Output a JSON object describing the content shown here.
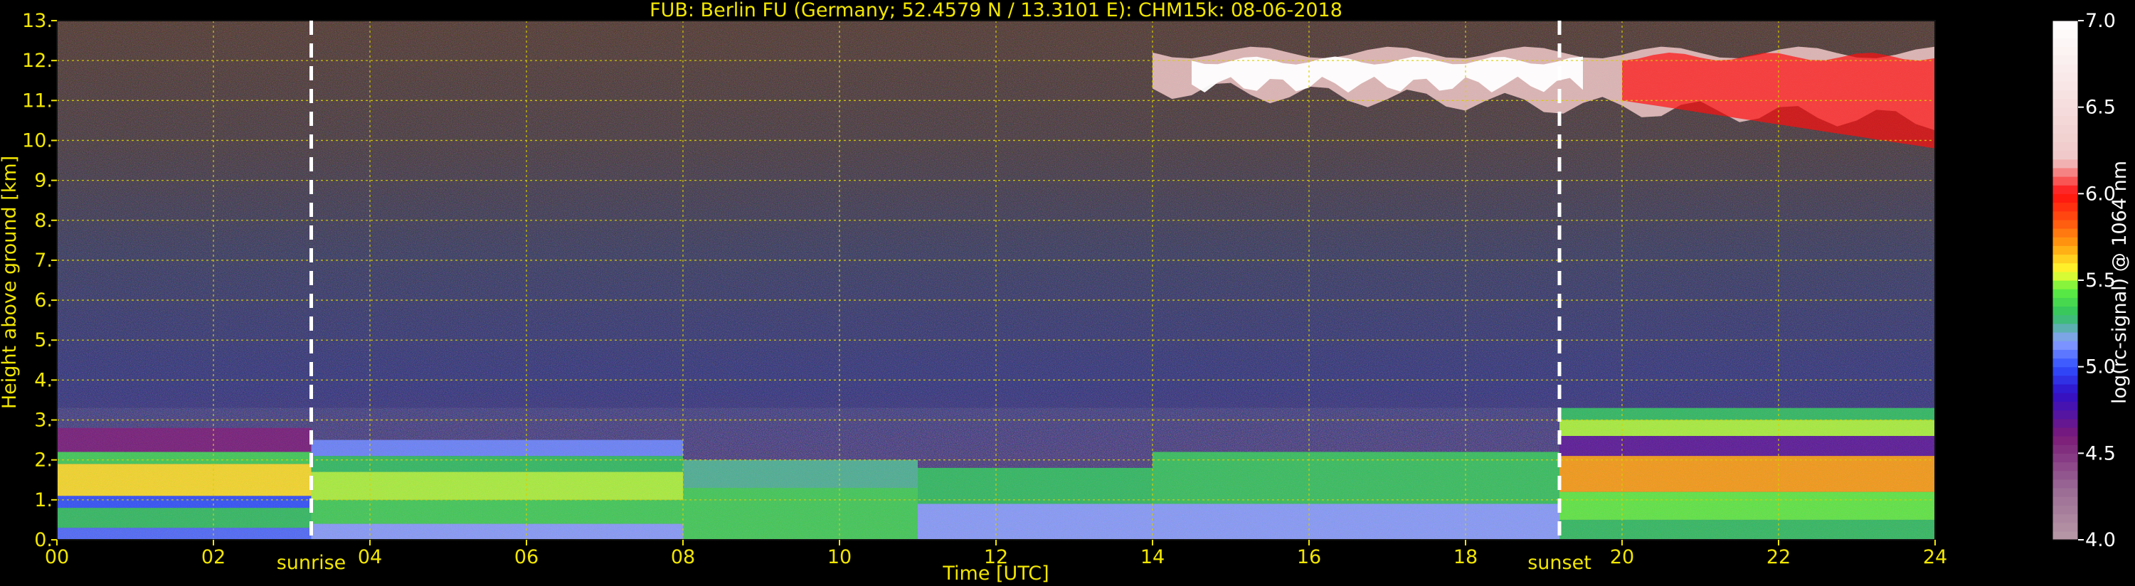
{
  "chart_data": {
    "type": "heatmap",
    "title": "FUB: Berlin FU (Germany; 52.4579 N / 13.3101 E):    CHM15k: 08-06-2018",
    "xlabel": "Time [UTC]",
    "ylabel": "Height above ground [km]",
    "xlim": [
      0,
      24
    ],
    "ylim": [
      0,
      13
    ],
    "x_ticks": [
      0,
      2,
      4,
      6,
      8,
      10,
      12,
      14,
      16,
      18,
      20,
      22,
      24
    ],
    "x_tick_labels": [
      "00",
      "02",
      "04",
      "06",
      "08",
      "10",
      "12",
      "14",
      "16",
      "18",
      "20",
      "22",
      "24"
    ],
    "y_ticks": [
      0,
      1,
      2,
      3,
      4,
      5,
      6,
      7,
      8,
      9,
      10,
      11,
      12,
      13
    ],
    "y_tick_labels": [
      "0.",
      "1.",
      "2.",
      "3.",
      "4.",
      "5.",
      "6.",
      "7.",
      "8.",
      "9.",
      "10.",
      "11.",
      "12.",
      "13."
    ],
    "grid": true,
    "markers": [
      {
        "label": "sunrise",
        "x": 3.25
      },
      {
        "label": "sunset",
        "x": 19.2
      }
    ],
    "colorbar": {
      "label": "log(rc-signal) @ 1064 nm",
      "min": 4.0,
      "max": 7.0,
      "ticks": [
        4.0,
        4.5,
        5.0,
        5.5,
        6.0,
        6.5,
        7.0
      ],
      "tick_labels": [
        "4.0",
        "4.5",
        "5.0",
        "5.5",
        "6.0",
        "6.5",
        "7.0"
      ]
    },
    "features": [
      {
        "kind": "boundary-layer",
        "x": [
          0,
          3.25
        ],
        "ymin": 0,
        "ymax": 2.2,
        "value": 5.6
      },
      {
        "kind": "boundary-layer",
        "x": [
          3.25,
          8
        ],
        "ymin": 0,
        "ymax": 2.0,
        "value": 5.4
      },
      {
        "kind": "convective-layer",
        "x": [
          8,
          19.2
        ],
        "ymin": 0,
        "ymax": 2.2,
        "value": 5.3
      },
      {
        "kind": "residual-layer",
        "x": [
          19.2,
          24
        ],
        "ymin": 0,
        "ymax": 3.3,
        "value": 5.7
      },
      {
        "kind": "cirrus-cloud",
        "x": [
          14,
          24
        ],
        "ymin": 9.6,
        "ymax": 12.3,
        "value": 6.8
      }
    ]
  }
}
